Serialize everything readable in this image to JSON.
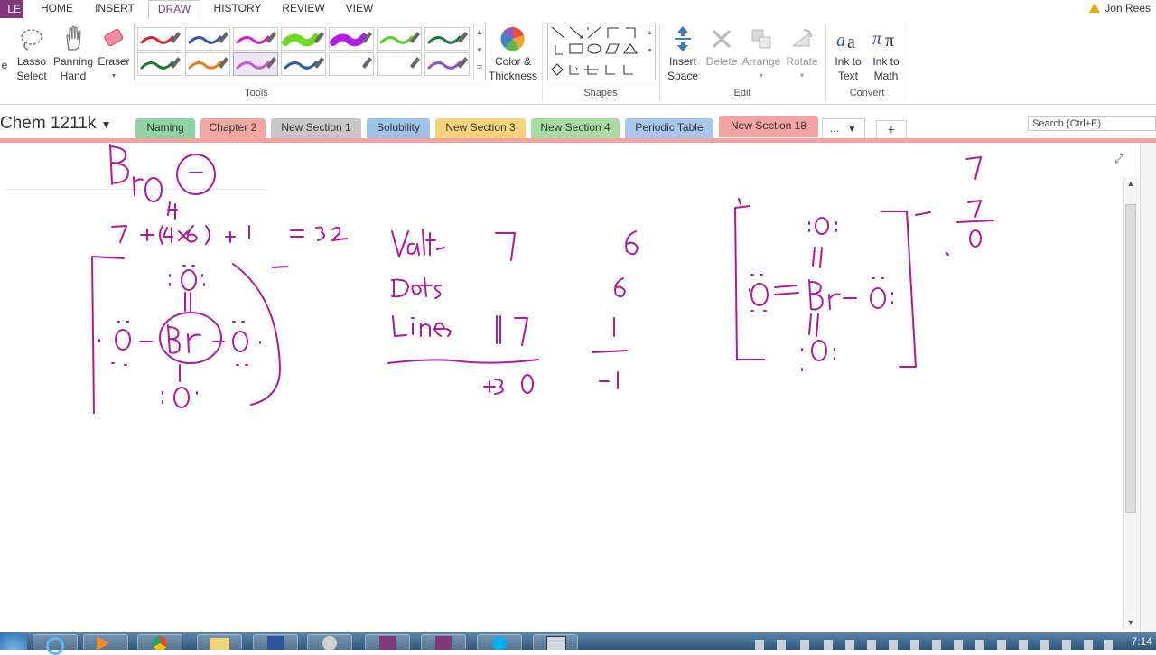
{
  "ribbon_tabs": {
    "file": "LE",
    "home": "HOME",
    "insert": "INSERT",
    "draw": "DRAW",
    "history": "HISTORY",
    "review": "REVIEW",
    "view": "VIEW"
  },
  "user": {
    "name": "Jon Rees"
  },
  "tools_group": {
    "label": "Tools",
    "partial_left": "e",
    "lasso": "Lasso\nSelect",
    "panning": "Panning\nHand",
    "eraser": "Eraser",
    "color_thickness": "Color &\nThickness",
    "pens_row1": [
      "#d9262a",
      "#2a5aa8",
      "#d51cc8",
      "#6ddc1f",
      "#b31ce6",
      "#52d11a",
      "#0f7a3b"
    ],
    "pens_row2": [
      "#1a7a2a",
      "#ee7a1a",
      "#c45ad0",
      "#2a5aa8",
      "#ffffff",
      "#ffffff",
      "#8b53c9"
    ]
  },
  "shapes_group": {
    "label": "Shapes"
  },
  "edit_group": {
    "label": "Edit",
    "insert_space": "Insert\nSpace",
    "delete": "Delete",
    "arrange": "Arrange",
    "rotate": "Rotate"
  },
  "convert_group": {
    "label": "Convert",
    "ink_to_text": "Ink to\nText",
    "ink_to_math": "Ink to\nMath"
  },
  "notebook": {
    "name": "Chem 1211k",
    "search_placeholder": "Search (Ctrl+E)",
    "sections": [
      {
        "label": "Naming",
        "color": "#8fd4a5"
      },
      {
        "label": "Chapter 2",
        "color": "#f2a9a1"
      },
      {
        "label": "New Section 1",
        "color": "#c7c7c7"
      },
      {
        "label": "Solubility",
        "color": "#9fc3e8"
      },
      {
        "label": "New Section 3",
        "color": "#f6d47a"
      },
      {
        "label": "New Section 4",
        "color": "#a9dca2"
      },
      {
        "label": "Periodic Table",
        "color": "#a9c7ec"
      },
      {
        "label": "New Section 18",
        "color": "#f4a3a3"
      }
    ],
    "more": "...",
    "add": "+"
  },
  "taskbar": {
    "clock": "7:14"
  },
  "colors": {
    "accent": "#80397b",
    "ink": "#b1189f",
    "active_section": "#f4a3a3"
  }
}
